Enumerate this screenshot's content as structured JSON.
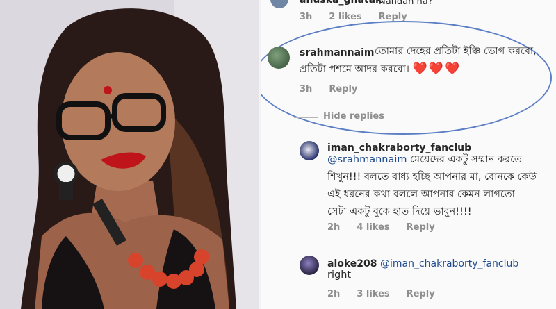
{
  "comments": [
    {
      "username": "anuska_ghatak",
      "text": "Nandan na?",
      "time": "3h",
      "likes": "2 likes",
      "reply": "Reply"
    },
    {
      "username": "srahmannaim",
      "text_line1": "তোমার দেহের প্রতিটা ইঞ্চি ভোগ করবো,",
      "text_line2": "প্রতিটা পশমে আদর করবো।",
      "hearts": "❤️❤️❤️",
      "time": "3h",
      "reply": "Reply",
      "hide_replies": "Hide replies"
    },
    {
      "username": "iman_chakraborty_fanclub",
      "mention": "@srahmannaim",
      "text_line1_rest": " মেয়েদের একটু সম্মান করতে",
      "text_line2": "শিখুন!!! বলতে বাধ্য হচ্ছি আপনার মা, বোনকে কেউ",
      "text_line3": "এই ধরনের কথা বললে আপনার কেমন লাগতো",
      "text_line4": "সেটা একটু বুকে হাত দিয়ে ভাবুন!!!!",
      "time": "2h",
      "likes": "4 likes",
      "reply": "Reply"
    },
    {
      "username": "aloke208",
      "mention": "@iman_chakraborty_fanclub",
      "text": "right",
      "time": "2h",
      "likes": "3 likes",
      "reply": "Reply"
    }
  ]
}
